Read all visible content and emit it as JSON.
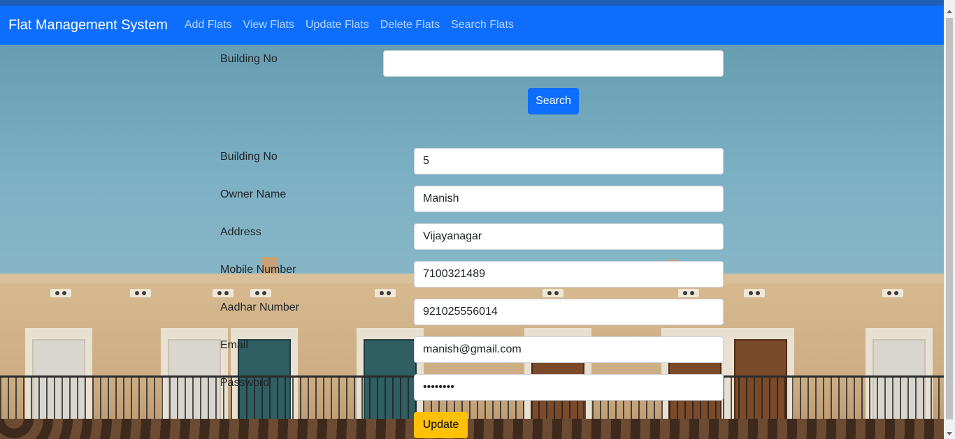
{
  "navbar": {
    "brand": "Flat Management System",
    "links": [
      "Add Flats",
      "View Flats",
      "Update Flats",
      "Delete Flats",
      "Search Flats"
    ]
  },
  "search": {
    "label": "Building No",
    "value": "",
    "button": "Search"
  },
  "form": {
    "fields": [
      {
        "label": "Building No",
        "value": "5"
      },
      {
        "label": "Owner Name",
        "value": "Manish"
      },
      {
        "label": "Address",
        "value": "Vijayanagar"
      },
      {
        "label": "Mobile Number",
        "value": "7100321489"
      },
      {
        "label": "Aadhar Number",
        "value": "921025556014"
      },
      {
        "label": "Email",
        "value": "manish@gmail.com"
      },
      {
        "label": "Password",
        "value": "••••••••"
      }
    ],
    "submit": "Update"
  },
  "colors": {
    "navbar": "#0d6efd",
    "primary_button": "#0d6efd",
    "warning_button": "#ffc107"
  }
}
